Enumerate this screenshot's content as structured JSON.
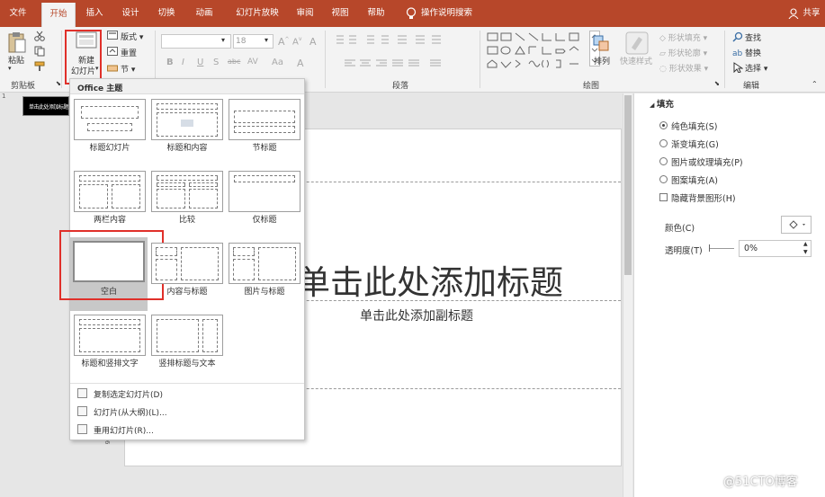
{
  "ribbon_tabs": [
    {
      "label": "文件"
    },
    {
      "label": "开始"
    },
    {
      "label": "插入"
    },
    {
      "label": "设计"
    },
    {
      "label": "切换"
    },
    {
      "label": "动画"
    },
    {
      "label": "幻灯片放映"
    },
    {
      "label": "审阅"
    },
    {
      "label": "视图"
    },
    {
      "label": "帮助"
    }
  ],
  "tell_me": "操作说明搜索",
  "share": "共享",
  "ribbon": {
    "paste": "粘贴",
    "new_slide_line1": "新建",
    "new_slide_line2": "幻灯片",
    "layout": "版式",
    "reset": "重置",
    "section": "节",
    "font_size": "18",
    "arrange": "排列",
    "quick_styles": "快速样式",
    "shape_fill": "形状填充",
    "shape_outline": "形状轮廓",
    "shape_effects": "形状效果",
    "find": "查找",
    "replace": "替换",
    "select": "选择",
    "group_clipboard": "剪贴板",
    "group_paragraph": "段落",
    "group_drawing": "绘图",
    "group_editing": "编辑"
  },
  "thumbnail_text": "单击此处添加标题",
  "slide": {
    "title_placeholder": "单击此处添加标题",
    "subtitle_placeholder": "单击此处添加副标题"
  },
  "format_pane": {
    "section": "填充",
    "options": [
      {
        "label": "纯色填充(S)",
        "selected": true
      },
      {
        "label": "渐变填充(G)",
        "selected": false
      },
      {
        "label": "图片或纹理填充(P)",
        "selected": false
      },
      {
        "label": "图案填充(A)",
        "selected": false
      }
    ],
    "hide_bg": "隐藏背景图形(H)",
    "color_label": "颜色(C)",
    "transparency_label": "透明度(T)",
    "transparency_value": "0%"
  },
  "dropdown": {
    "header": "Office 主题",
    "layouts": [
      {
        "name": "标题幻灯片"
      },
      {
        "name": "标题和内容"
      },
      {
        "name": "节标题"
      },
      {
        "name": "两栏内容"
      },
      {
        "name": "比较"
      },
      {
        "name": "仅标题"
      },
      {
        "name": "空白"
      },
      {
        "name": "内容与标题"
      },
      {
        "name": "图片与标题"
      },
      {
        "name": "标题和竖排文字"
      },
      {
        "name": "竖排标题与文本"
      }
    ],
    "menu": [
      {
        "label": "复制选定幻灯片(D)"
      },
      {
        "label": "幻灯片(从大纲)(L)..."
      },
      {
        "label": "重用幻灯片(R)..."
      }
    ]
  },
  "watermark": "@51CTO博客",
  "colors": {
    "accent": "#b7472a",
    "highlight": "#e0302a"
  }
}
